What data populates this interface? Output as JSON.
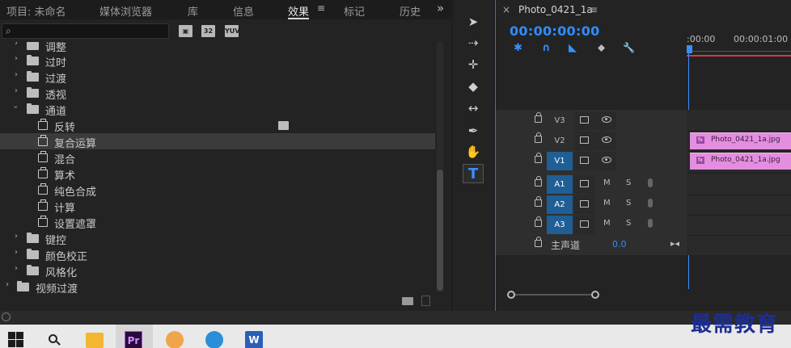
{
  "tabs": [
    {
      "label": "项目: 未命名",
      "active": false
    },
    {
      "label": "媒体浏览器",
      "active": false
    },
    {
      "label": "库",
      "active": false
    },
    {
      "label": "信息",
      "active": false
    },
    {
      "label": "效果",
      "active": true
    },
    {
      "label": "标记",
      "active": false
    },
    {
      "label": "历史",
      "active": false
    }
  ],
  "tab_menu_icon": "≡",
  "tab_overflow_icon": "»",
  "search": {
    "placeholder": "",
    "icon": "search-icon"
  },
  "filter_buttons": [
    "accelerated-effects-icon",
    "32",
    "YUV"
  ],
  "tree": [
    {
      "label": "调整",
      "kind": "folder",
      "expanded": false
    },
    {
      "label": "过时",
      "kind": "folder",
      "expanded": false
    },
    {
      "label": "过渡",
      "kind": "folder",
      "expanded": false
    },
    {
      "label": "透视",
      "kind": "folder",
      "expanded": false
    },
    {
      "label": "通道",
      "kind": "folder",
      "expanded": true
    },
    {
      "label": "反转",
      "kind": "effect",
      "accelerated": true
    },
    {
      "label": "复合运算",
      "kind": "effect",
      "selected": true
    },
    {
      "label": "混合",
      "kind": "effect"
    },
    {
      "label": "算术",
      "kind": "effect"
    },
    {
      "label": "纯色合成",
      "kind": "effect"
    },
    {
      "label": "计算",
      "kind": "effect"
    },
    {
      "label": "设置遮罩",
      "kind": "effect"
    },
    {
      "label": "键控",
      "kind": "folder",
      "expanded": false
    },
    {
      "label": "颜色校正",
      "kind": "folder",
      "expanded": false
    },
    {
      "label": "风格化",
      "kind": "folder",
      "expanded": false
    },
    {
      "label": "视频过渡",
      "kind": "folder",
      "expanded": false,
      "root": true
    }
  ],
  "tools": [
    {
      "name": "selection-tool",
      "glyph": "➤"
    },
    {
      "name": "track-select-tool",
      "glyph": "⇢"
    },
    {
      "name": "ripple-edit-tool",
      "glyph": "✛"
    },
    {
      "name": "razor-tool",
      "glyph": "◆"
    },
    {
      "name": "slip-tool",
      "glyph": "↔"
    },
    {
      "name": "pen-tool",
      "glyph": "✒"
    },
    {
      "name": "hand-tool",
      "glyph": "✋"
    },
    {
      "name": "type-tool",
      "glyph": "T",
      "active": true
    }
  ],
  "sequence": {
    "tab_close": "×",
    "name": "Photo_0421_1a",
    "menu": "≡",
    "timecode": "00:00:00:00",
    "ruler_labels": [
      ":00:00",
      "00:00:01:00"
    ]
  },
  "timeline_tools": [
    {
      "name": "snap-icon",
      "glyph": "✱"
    },
    {
      "name": "linked-selection-icon",
      "glyph": "∩"
    },
    {
      "name": "add-marker-icon",
      "glyph": "◣"
    },
    {
      "name": "marker-icon",
      "glyph": "⬥"
    },
    {
      "name": "wrench-icon",
      "glyph": "🔧"
    }
  ],
  "tracks": [
    {
      "name": "V3",
      "type": "video",
      "targeted": false
    },
    {
      "name": "V2",
      "type": "video",
      "targeted": false
    },
    {
      "name": "V1",
      "type": "video",
      "targeted": true
    },
    {
      "name": "A1",
      "type": "audio",
      "targeted": true
    },
    {
      "name": "A2",
      "type": "audio",
      "targeted": true
    },
    {
      "name": "A3",
      "type": "audio",
      "targeted": true
    }
  ],
  "audio_buttons": {
    "mute": "M",
    "solo": "S"
  },
  "master": {
    "label": "主声道",
    "value": "0.0",
    "icon": "▸◂"
  },
  "clips": [
    {
      "track": "V2",
      "name": "Photo_0421_1a.jpg",
      "fx": "fx"
    },
    {
      "track": "V1",
      "name": "Photo_0421_1a.jpg",
      "fx": "fx"
    }
  ],
  "colors": {
    "accent": "#2f8cff",
    "clip": "#e48ee0",
    "work_area": "#d63b3b",
    "target": "#1f5f95"
  },
  "taskbar": [
    "windows-start-icon",
    "search-icon",
    "file-explorer-icon",
    "premiere-pro-icon",
    "app-icon",
    "edge-icon",
    "word-icon"
  ],
  "taskbar_labels": {
    "premiere": "Pr",
    "word": "W"
  },
  "watermark": "最需教育"
}
